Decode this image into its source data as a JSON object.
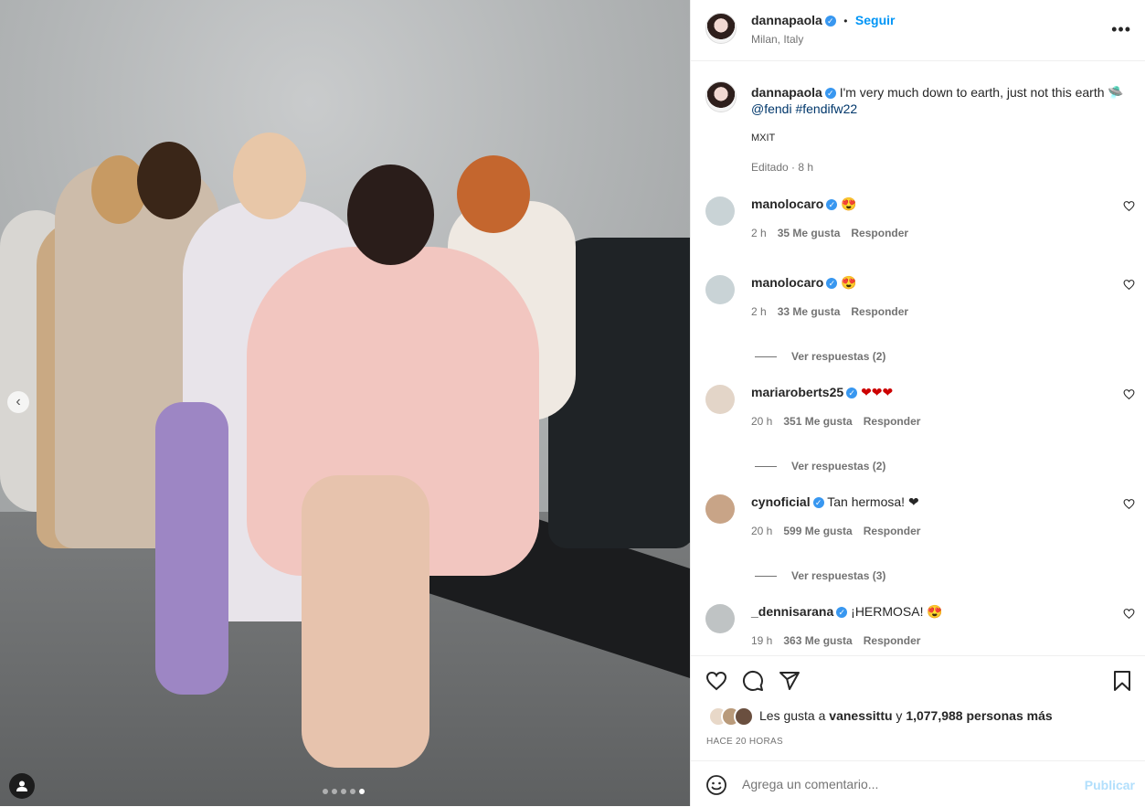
{
  "post": {
    "username": "dannapaola",
    "follow_label": "Seguir",
    "separator": "•",
    "location": "Milan, Italy",
    "more": "•••"
  },
  "caption": {
    "username": "dannapaola",
    "text": "I'm very much down to earth, just not this earth 🛸",
    "mention": "@fendi",
    "hashtag": "#fendifw22",
    "extra": "MXIT",
    "meta": "Editado · 8 h"
  },
  "comments": [
    {
      "username": "manolocaro",
      "text": "😍",
      "time": "2 h",
      "likes": "35 Me gusta",
      "reply": "Responder"
    },
    {
      "username": "manolocaro",
      "text": "😍",
      "time": "2 h",
      "likes": "33 Me gusta",
      "reply": "Responder",
      "view_replies": "Ver respuestas (2)"
    },
    {
      "username": "mariaroberts25",
      "text": "❤❤❤",
      "time": "20 h",
      "likes": "351 Me gusta",
      "reply": "Responder",
      "view_replies": "Ver respuestas (2)"
    },
    {
      "username": "cynoficial",
      "text": "Tan hermosa! ❤",
      "time": "20 h",
      "likes": "599 Me gusta",
      "reply": "Responder",
      "view_replies": "Ver respuestas (3)"
    },
    {
      "username": "_dennisarana",
      "text": "¡HERMOSA! 😍",
      "time": "19 h",
      "likes": "363 Me gusta",
      "reply": "Responder"
    }
  ],
  "likes": {
    "prefix": "Les gusta a",
    "user": "vanessittu",
    "connector": "y",
    "count": "1,077,988 personas más"
  },
  "timestamp": "HACE 20 HORAS",
  "comment_box": {
    "placeholder": "Agrega un comentario...",
    "publish": "Publicar"
  },
  "media": {
    "slide_count": 5,
    "active_slide": 5
  },
  "colors": {
    "link": "#00376b",
    "follow": "#0095f6",
    "verified": "#3897f0",
    "heart": "#c00"
  }
}
